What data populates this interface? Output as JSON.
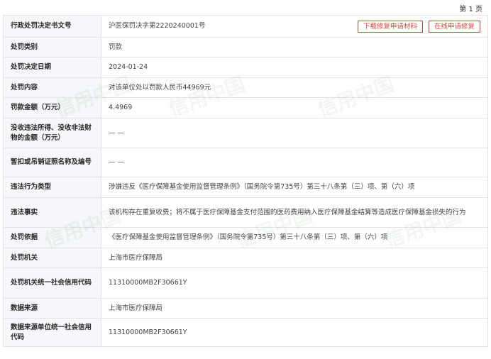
{
  "page_indicator": "第 1 页",
  "actions": {
    "download_label": "下载修复申请材料",
    "online_label": "在线申请修复"
  },
  "rows": [
    {
      "label": "行政处罚决定书文号",
      "value": "沪医保罚决字第2220240001号"
    },
    {
      "label": "处罚类别",
      "value": "罚款"
    },
    {
      "label": "处罚决定日期",
      "value": "2024-01-24"
    },
    {
      "label": "处罚内容",
      "value": "对该单位处以罚款人民币44969元"
    },
    {
      "label": "罚款金额（万元）",
      "value": "4.4969"
    },
    {
      "label": "没收违法所得、没收非法财物的金额（万元）",
      "value": "— —"
    },
    {
      "label": "暂扣或吊销证照名称及编号",
      "value": "— —"
    },
    {
      "label": "违法行为类型",
      "value": "涉嫌违反《医疗保障基金使用监督管理条例》（国务院令第735号）第三十八条第（三）项、第（六）项"
    },
    {
      "label": "违法事实",
      "value": "该机构存在重复收费；将不属于医疗保障基金支付范围的医药费用纳入医疗保障基金结算等造成医疗保障基金损失的行为"
    },
    {
      "label": "处罚依据",
      "value": "《医疗保障基金使用监督管理条例》（国务院令第735号）第三十八条第（三）项、第（六）项"
    },
    {
      "label": "处罚机关",
      "value": "上海市医疗保障局"
    },
    {
      "label": "处罚机关统一社会信用代码",
      "value": "11310000MB2F30661Y"
    },
    {
      "label": "数据来源",
      "value": "上海市医疗保障局"
    },
    {
      "label": "数据来源单位统一社会信用代码",
      "value": "11310000MB2F30661Y"
    }
  ],
  "watermark_text": "信用中国"
}
